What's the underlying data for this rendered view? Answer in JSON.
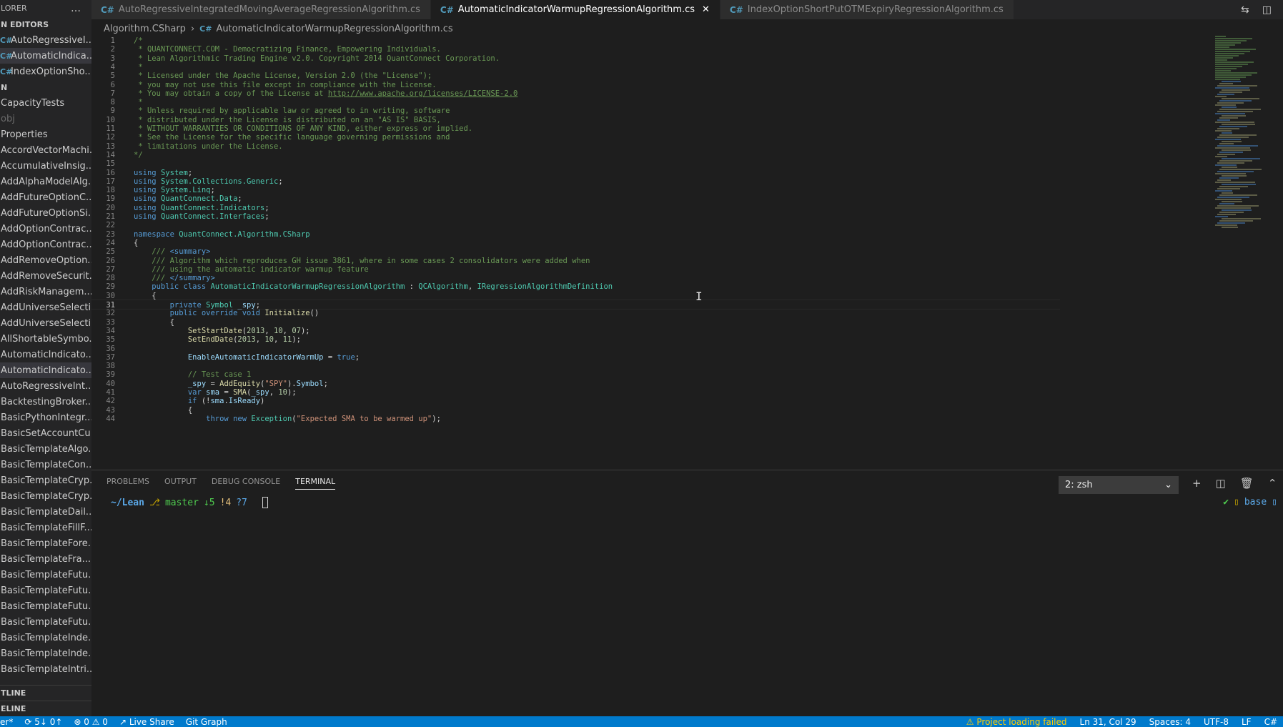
{
  "sidebar": {
    "header": "LORER",
    "more_icon": "…",
    "open_editors_label": "N EDITORS",
    "open_editors": [
      {
        "label": "AutoRegressiveI...",
        "active": false
      },
      {
        "label": "AutomaticIndica...",
        "active": true
      },
      {
        "label": "IndexOptionSho...",
        "active": false
      }
    ],
    "folder_label": "N",
    "tree": [
      {
        "label": "CapacityTests",
        "dim": false,
        "active": false
      },
      {
        "label": "obj",
        "dim": true,
        "active": false
      },
      {
        "label": "Properties",
        "dim": false,
        "active": false
      },
      {
        "label": "AccordVectorMachi...",
        "dim": false,
        "active": false
      },
      {
        "label": "AccumulativeInsig...",
        "dim": false,
        "active": false
      },
      {
        "label": "AddAlphaModelAlg...",
        "dim": false,
        "active": false
      },
      {
        "label": "AddFutureOptionC...",
        "dim": false,
        "active": false
      },
      {
        "label": "AddFutureOptionSi...",
        "dim": false,
        "active": false
      },
      {
        "label": "AddOptionContrac...",
        "dim": false,
        "active": false
      },
      {
        "label": "AddOptionContrac...",
        "dim": false,
        "active": false
      },
      {
        "label": "AddRemoveOption...",
        "dim": false,
        "active": false
      },
      {
        "label": "AddRemoveSecurit...",
        "dim": false,
        "active": false
      },
      {
        "label": "AddRiskManagem...",
        "dim": false,
        "active": false
      },
      {
        "label": "AddUniverseSelecti...",
        "dim": false,
        "active": false
      },
      {
        "label": "AddUniverseSelecti...",
        "dim": false,
        "active": false
      },
      {
        "label": "AllShortableSymbo...",
        "dim": false,
        "active": false
      },
      {
        "label": "AutomaticIndicato...",
        "dim": false,
        "active": false
      },
      {
        "label": "AutomaticIndicato...",
        "dim": false,
        "active": true
      },
      {
        "label": "AutoRegressiveInt...",
        "dim": false,
        "active": false
      },
      {
        "label": "BacktestingBroker...",
        "dim": false,
        "active": false
      },
      {
        "label": "BasicPythonIntegr...",
        "dim": false,
        "active": false
      },
      {
        "label": "BasicSetAccountCu...",
        "dim": false,
        "active": false
      },
      {
        "label": "BasicTemplateAlgo...",
        "dim": false,
        "active": false
      },
      {
        "label": "BasicTemplateCon...",
        "dim": false,
        "active": false
      },
      {
        "label": "BasicTemplateCryp...",
        "dim": false,
        "active": false
      },
      {
        "label": "BasicTemplateCryp...",
        "dim": false,
        "active": false
      },
      {
        "label": "BasicTemplateDail...",
        "dim": false,
        "active": false
      },
      {
        "label": "BasicTemplateFillF...",
        "dim": false,
        "active": false
      },
      {
        "label": "BasicTemplateFore...",
        "dim": false,
        "active": false
      },
      {
        "label": "BasicTemplateFra...",
        "dim": false,
        "active": false
      },
      {
        "label": "BasicTemplateFutu...",
        "dim": false,
        "active": false
      },
      {
        "label": "BasicTemplateFutu...",
        "dim": false,
        "active": false
      },
      {
        "label": "BasicTemplateFutu...",
        "dim": false,
        "active": false
      },
      {
        "label": "BasicTemplateFutu...",
        "dim": false,
        "active": false
      },
      {
        "label": "BasicTemplateInde...",
        "dim": false,
        "active": false
      },
      {
        "label": "BasicTemplateInde...",
        "dim": false,
        "active": false
      },
      {
        "label": "BasicTemplateIntri...",
        "dim": false,
        "active": false
      }
    ],
    "outline_label": "TLINE",
    "timeline_label": "ELINE"
  },
  "tabs": [
    {
      "label": "AutoRegressiveIntegratedMovingAverageRegressionAlgorithm.cs",
      "active": false
    },
    {
      "label": "AutomaticIndicatorWarmupRegressionAlgorithm.cs",
      "active": true
    },
    {
      "label": "IndexOptionShortPutOTMExpiryRegressionAlgorithm.cs",
      "active": false
    }
  ],
  "tab_icon": "C#",
  "close_icon": "✕",
  "breadcrumb": {
    "folder": "Algorithm.CSharp",
    "file": "AutomaticIndicatorWarmupRegressionAlgorithm.cs"
  },
  "editor": {
    "current_line": 31,
    "lines": [
      [
        [
          "c-comment",
          "/*"
        ]
      ],
      [
        [
          "c-comment",
          " * QUANTCONNECT.COM - Democratizing Finance, Empowering Individuals."
        ]
      ],
      [
        [
          "c-comment",
          " * Lean Algorithmic Trading Engine v2.0. Copyright 2014 QuantConnect Corporation."
        ]
      ],
      [
        [
          "c-comment",
          " *"
        ]
      ],
      [
        [
          "c-comment",
          " * Licensed under the Apache License, Version 2.0 (the \"License\");"
        ]
      ],
      [
        [
          "c-comment",
          " * you may not use this file except in compliance with the License."
        ]
      ],
      [
        [
          "c-comment",
          " * You may obtain a copy of the License at "
        ],
        [
          "c-link",
          "http://www.apache.org/licenses/LICENSE-2.0"
        ]
      ],
      [
        [
          "c-comment",
          " *"
        ]
      ],
      [
        [
          "c-comment",
          " * Unless required by applicable law or agreed to in writing, software"
        ]
      ],
      [
        [
          "c-comment",
          " * distributed under the License is distributed on an \"AS IS\" BASIS,"
        ]
      ],
      [
        [
          "c-comment",
          " * WITHOUT WARRANTIES OR CONDITIONS OF ANY KIND, either express or implied."
        ]
      ],
      [
        [
          "c-comment",
          " * See the License for the specific language governing permissions and"
        ]
      ],
      [
        [
          "c-comment",
          " * limitations under the License."
        ]
      ],
      [
        [
          "c-comment",
          "*/"
        ]
      ],
      [],
      [
        [
          "c-kw",
          "using "
        ],
        [
          "c-ns",
          "System"
        ],
        [
          "c-plain",
          ";"
        ]
      ],
      [
        [
          "c-kw",
          "using "
        ],
        [
          "c-ns",
          "System.Collections.Generic"
        ],
        [
          "c-plain",
          ";"
        ]
      ],
      [
        [
          "c-kw",
          "using "
        ],
        [
          "c-ns",
          "System.Linq"
        ],
        [
          "c-plain",
          ";"
        ]
      ],
      [
        [
          "c-kw",
          "using "
        ],
        [
          "c-ns",
          "QuantConnect.Data"
        ],
        [
          "c-plain",
          ";"
        ]
      ],
      [
        [
          "c-kw",
          "using "
        ],
        [
          "c-ns",
          "QuantConnect.Indicators"
        ],
        [
          "c-plain",
          ";"
        ]
      ],
      [
        [
          "c-kw",
          "using "
        ],
        [
          "c-ns",
          "QuantConnect.Interfaces"
        ],
        [
          "c-plain",
          ";"
        ]
      ],
      [],
      [
        [
          "c-kw",
          "namespace "
        ],
        [
          "c-ns",
          "QuantConnect.Algorithm.CSharp"
        ]
      ],
      [
        [
          "c-plain",
          "{"
        ]
      ],
      [
        [
          "c-comment",
          "    /// "
        ],
        [
          "c-kw",
          "<summary>"
        ]
      ],
      [
        [
          "c-comment",
          "    /// Algorithm which reproduces GH issue 3861, where in some cases 2 consolidators were added when"
        ]
      ],
      [
        [
          "c-comment",
          "    /// using the automatic indicator warmup feature"
        ]
      ],
      [
        [
          "c-comment",
          "    /// "
        ],
        [
          "c-kw",
          "</summary>"
        ]
      ],
      [
        [
          "c-kw",
          "    public class "
        ],
        [
          "c-ns",
          "AutomaticIndicatorWarmupRegressionAlgorithm"
        ],
        [
          "c-plain",
          " : "
        ],
        [
          "c-ns",
          "QCAlgorithm"
        ],
        [
          "c-plain",
          ", "
        ],
        [
          "c-ns",
          "IRegressionAlgorithmDefinition"
        ]
      ],
      [
        [
          "c-plain",
          "    {"
        ]
      ],
      [
        [
          "c-kw",
          "        private "
        ],
        [
          "c-ns",
          "Symbol"
        ],
        [
          "c-var",
          " _spy"
        ],
        [
          "c-plain",
          ";"
        ]
      ],
      [
        [
          "c-kw",
          "        public override void "
        ],
        [
          "c-fn",
          "Initialize"
        ],
        [
          "c-plain",
          "()"
        ]
      ],
      [
        [
          "c-plain",
          "        {"
        ]
      ],
      [
        [
          "c-fn",
          "            SetStartDate"
        ],
        [
          "c-plain",
          "("
        ],
        [
          "c-num",
          "2013"
        ],
        [
          "c-plain",
          ", "
        ],
        [
          "c-num",
          "10"
        ],
        [
          "c-plain",
          ", "
        ],
        [
          "c-num",
          "07"
        ],
        [
          "c-plain",
          ");"
        ]
      ],
      [
        [
          "c-fn",
          "            SetEndDate"
        ],
        [
          "c-plain",
          "("
        ],
        [
          "c-num",
          "2013"
        ],
        [
          "c-plain",
          ", "
        ],
        [
          "c-num",
          "10"
        ],
        [
          "c-plain",
          ", "
        ],
        [
          "c-num",
          "11"
        ],
        [
          "c-plain",
          ");"
        ]
      ],
      [],
      [
        [
          "c-var",
          "            EnableAutomaticIndicatorWarmUp"
        ],
        [
          "c-plain",
          " = "
        ],
        [
          "c-kw",
          "true"
        ],
        [
          "c-plain",
          ";"
        ]
      ],
      [],
      [
        [
          "c-comment",
          "            // Test case 1"
        ]
      ],
      [
        [
          "c-var",
          "            _spy"
        ],
        [
          "c-plain",
          " = "
        ],
        [
          "c-fn",
          "AddEquity"
        ],
        [
          "c-plain",
          "("
        ],
        [
          "c-str",
          "\"SPY\""
        ],
        [
          "c-plain",
          ")."
        ],
        [
          "c-var",
          "Symbol"
        ],
        [
          "c-plain",
          ";"
        ]
      ],
      [
        [
          "c-kw",
          "            var "
        ],
        [
          "c-var",
          "sma"
        ],
        [
          "c-plain",
          " = "
        ],
        [
          "c-fn",
          "SMA"
        ],
        [
          "c-plain",
          "("
        ],
        [
          "c-var",
          "_spy"
        ],
        [
          "c-plain",
          ", "
        ],
        [
          "c-num",
          "10"
        ],
        [
          "c-plain",
          ");"
        ]
      ],
      [
        [
          "c-kw",
          "            if "
        ],
        [
          "c-plain",
          "(!"
        ],
        [
          "c-var",
          "sma"
        ],
        [
          "c-plain",
          "."
        ],
        [
          "c-var",
          "IsReady"
        ],
        [
          "c-plain",
          ")"
        ]
      ],
      [
        [
          "c-plain",
          "            {"
        ]
      ],
      [
        [
          "c-kw",
          "                throw new "
        ],
        [
          "c-ns",
          "Exception"
        ],
        [
          "c-plain",
          "("
        ],
        [
          "c-str",
          "\"Expected SMA to be warmed up\""
        ],
        [
          "c-plain",
          ");"
        ]
      ]
    ]
  },
  "panel": {
    "tabs": [
      "PROBLEMS",
      "OUTPUT",
      "DEBUG CONSOLE",
      "TERMINAL"
    ],
    "active_tab": "TERMINAL",
    "terminal_select": "2: zsh",
    "terminal_path": "~/Lean",
    "terminal_branch": "master",
    "terminal_behind": "↓5",
    "terminal_modified": "!4",
    "terminal_untracked": "?7",
    "terminal_status_ok": "✔",
    "terminal_env": "base"
  },
  "statusbar": {
    "branch": "er*",
    "sync": "5↓ 0↑",
    "problems": "0 ⚠ 0",
    "live_share": "Live Share",
    "git_graph": "Git Graph",
    "project_warning": "Project loading failed",
    "position": "Ln 31, Col 29",
    "spaces": "Spaces: 4",
    "encoding": "UTF-8",
    "eol": "LF",
    "language": "C#"
  }
}
